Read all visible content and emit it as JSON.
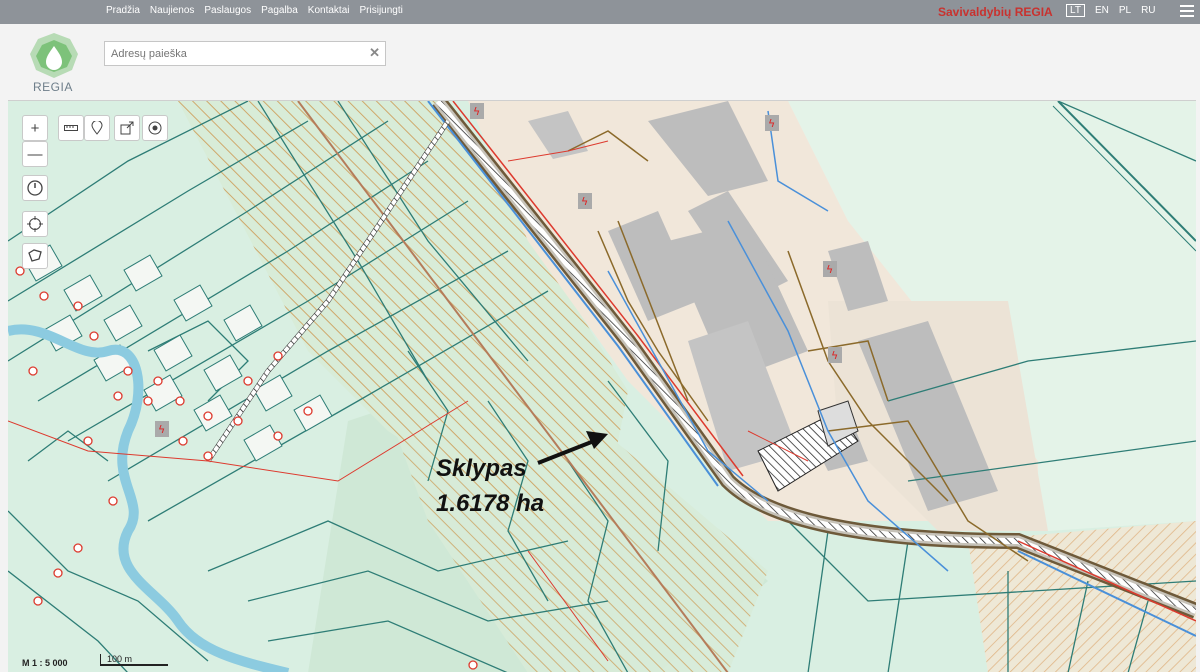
{
  "nav": {
    "items": [
      "Pradžia",
      "Naujienos",
      "Paslaugos",
      "Pagalba",
      "Kontaktai",
      "Prisijungti"
    ]
  },
  "brand": "Savivaldybių REGIA",
  "languages": [
    "LT",
    "EN",
    "PL",
    "RU"
  ],
  "active_language": "LT",
  "logo": {
    "text": "REGIA",
    "icon": "regia-drop-logo"
  },
  "search": {
    "placeholder": "Adresų paieška",
    "value": ""
  },
  "map": {
    "annotation_line1": "Sklypas",
    "annotation_line2": "1.6178 ha",
    "scale_text": "M 1 : 5 000",
    "scalebar_text": "100 m",
    "colors": {
      "parcel": "#2e7d76",
      "river": "#7fc6dc",
      "hatch": "#c9a36b",
      "building": "#bdbdbd",
      "road": "#dd3a2e"
    }
  },
  "tools": {
    "zoom_in": "+",
    "zoom_out": "—",
    "icons": [
      "measure-icon",
      "marker-icon",
      "share-icon",
      "locate-icon",
      "compass-icon",
      "target-icon",
      "polygon-icon"
    ]
  }
}
